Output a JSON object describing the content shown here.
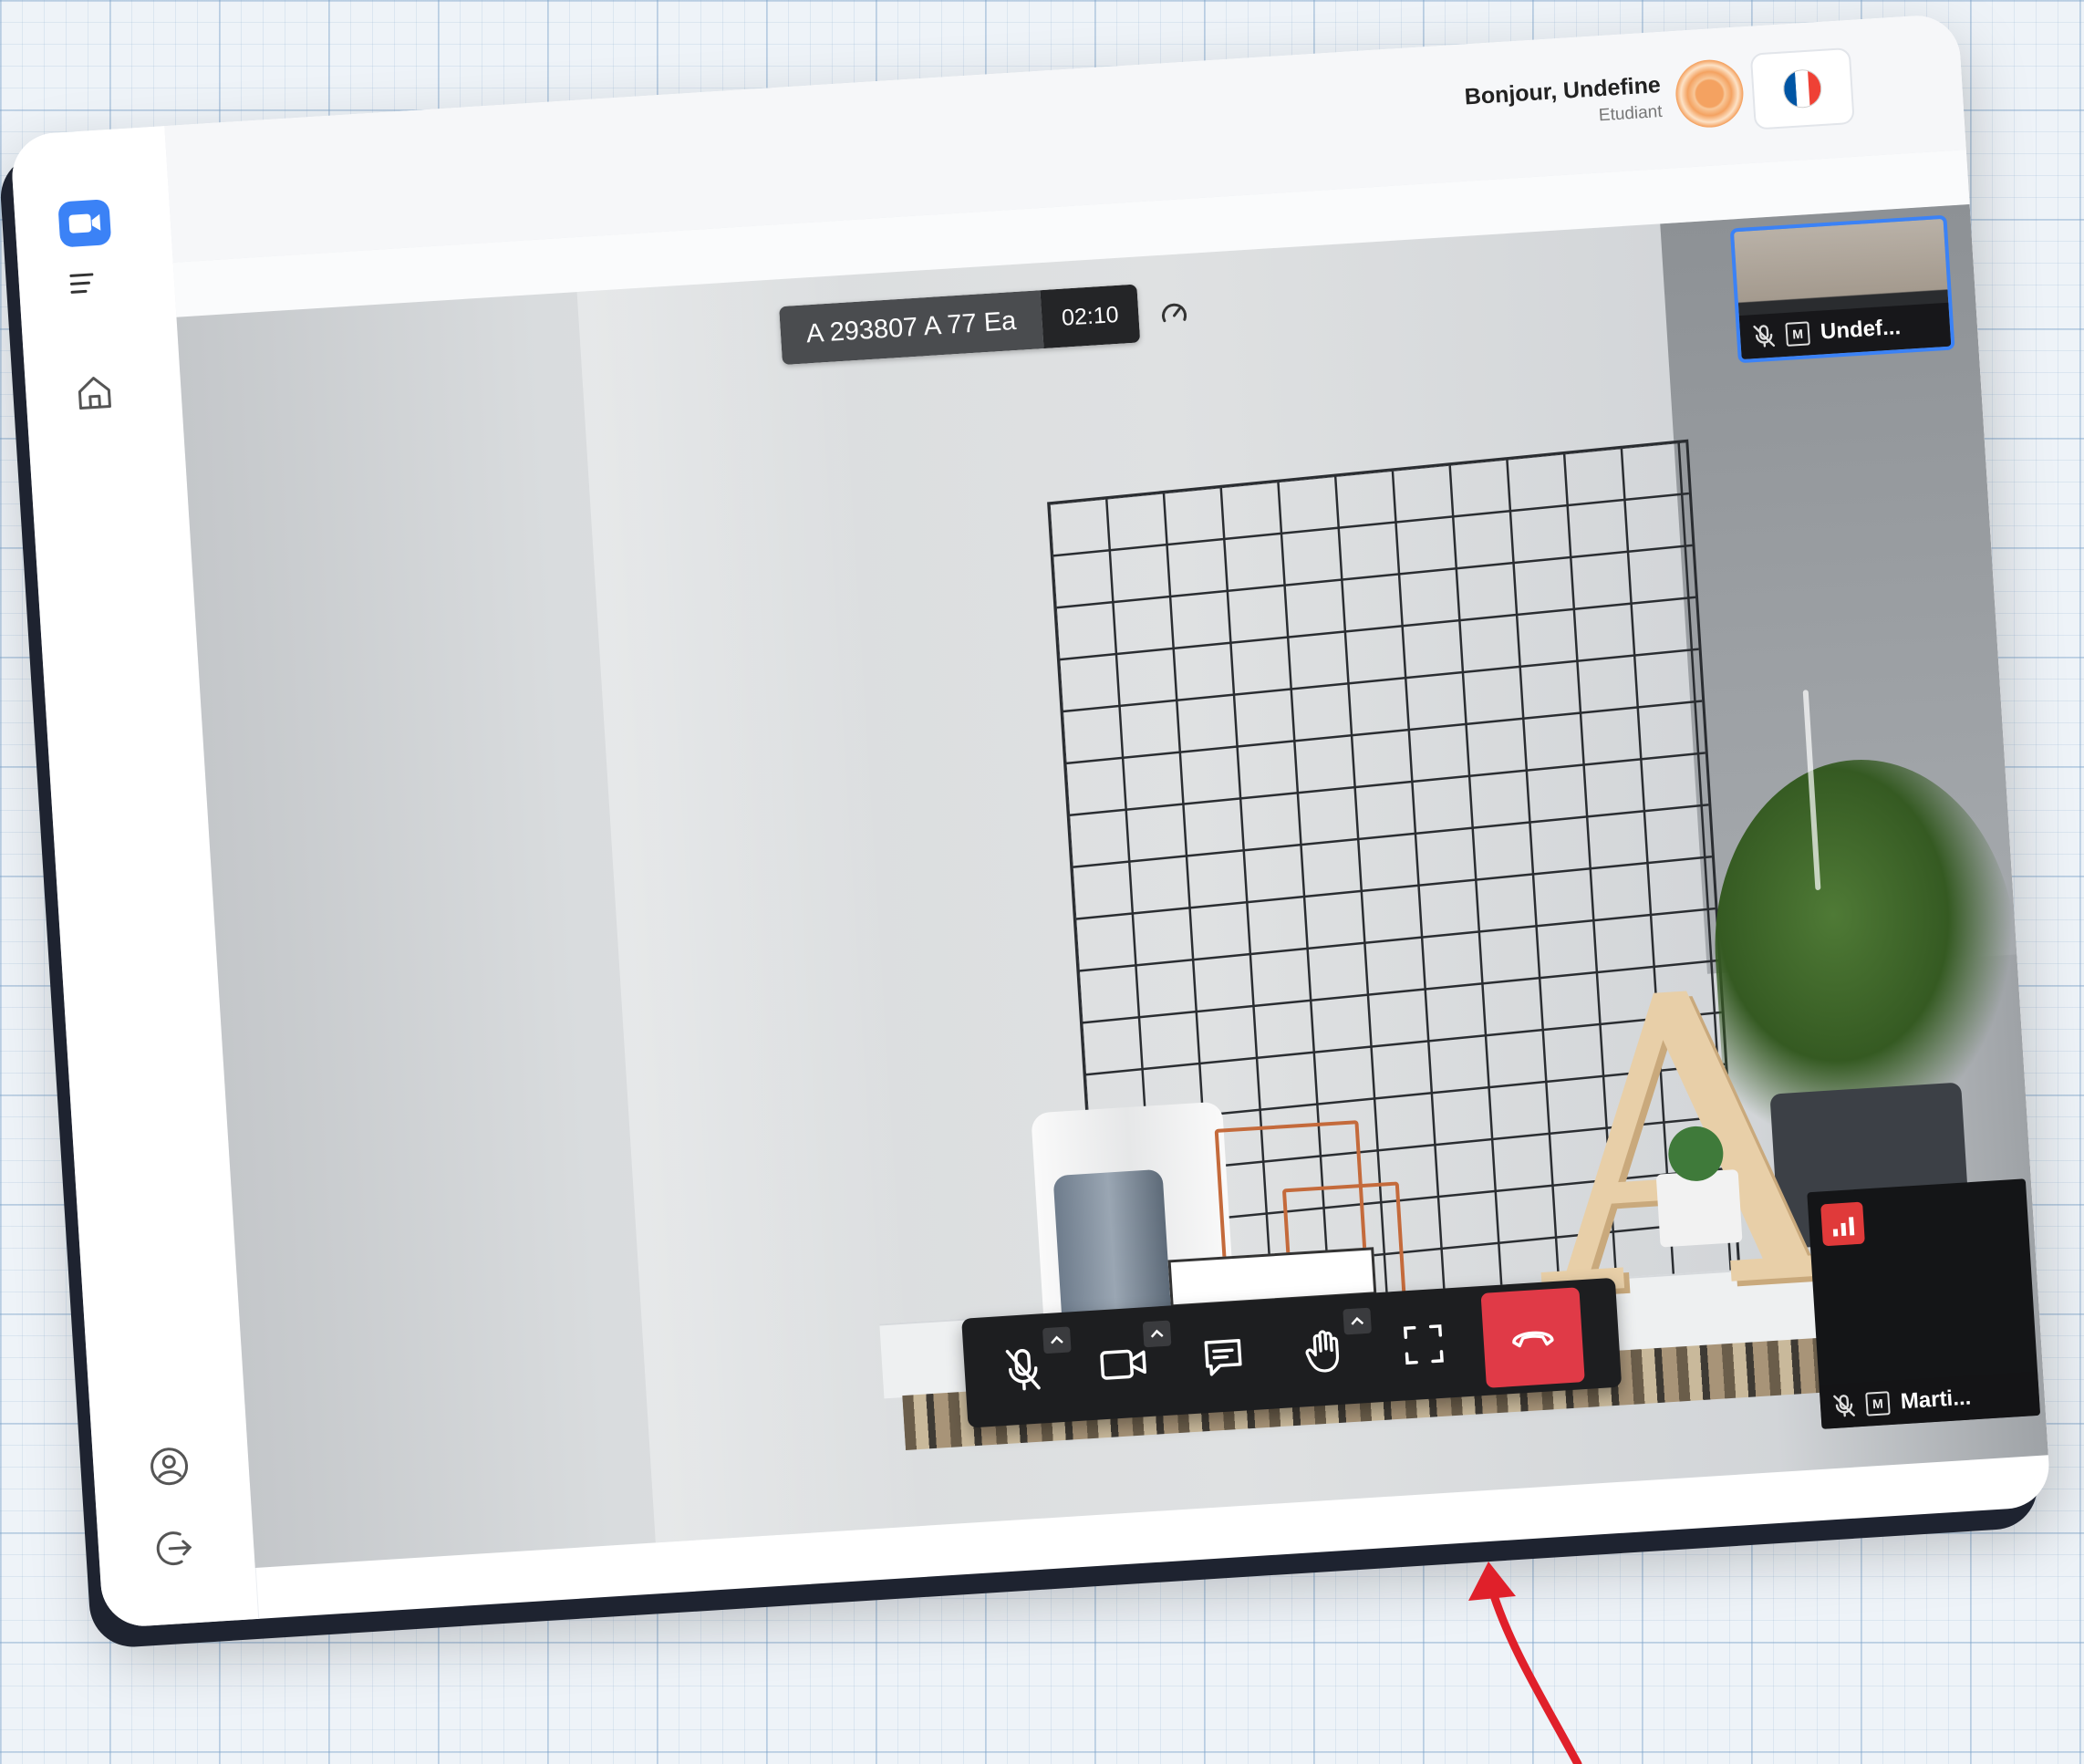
{
  "header": {
    "greeting": "Bonjour, Undefine",
    "role": "Etudiant",
    "language_flag": [
      "#0055A4",
      "#FFFFFF",
      "#EF4135"
    ]
  },
  "sidebar": {
    "logo_icon": "video-camera-icon",
    "items": [
      {
        "name": "menu",
        "icon": "hamburger-icon"
      },
      {
        "name": "home",
        "icon": "home-icon"
      },
      {
        "name": "profile",
        "icon": "user-circle-icon"
      },
      {
        "name": "logout",
        "icon": "logout-icon"
      }
    ]
  },
  "meeting": {
    "id": "A 293807 A 77 Ea",
    "timer": "02:10"
  },
  "participants": {
    "self": {
      "name": "Undef...",
      "badge": "M",
      "muted": true
    },
    "remote": {
      "name": "Marti...",
      "badge": "M",
      "muted": true
    }
  },
  "controls": {
    "microphone": {
      "icon": "microphone-off-icon",
      "state": "muted"
    },
    "camera": {
      "icon": "video-camera-icon"
    },
    "chat": {
      "icon": "chat-bubble-icon"
    },
    "raise_hand": {
      "icon": "hand-icon"
    },
    "fullscreen": {
      "icon": "fullscreen-icon"
    },
    "end_call": {
      "icon": "phone-hangup-icon",
      "color": "#e03a47"
    }
  },
  "colors": {
    "accent": "#3b82f6",
    "danger": "#e03a47",
    "annotation_arrow": "#e0202a"
  }
}
